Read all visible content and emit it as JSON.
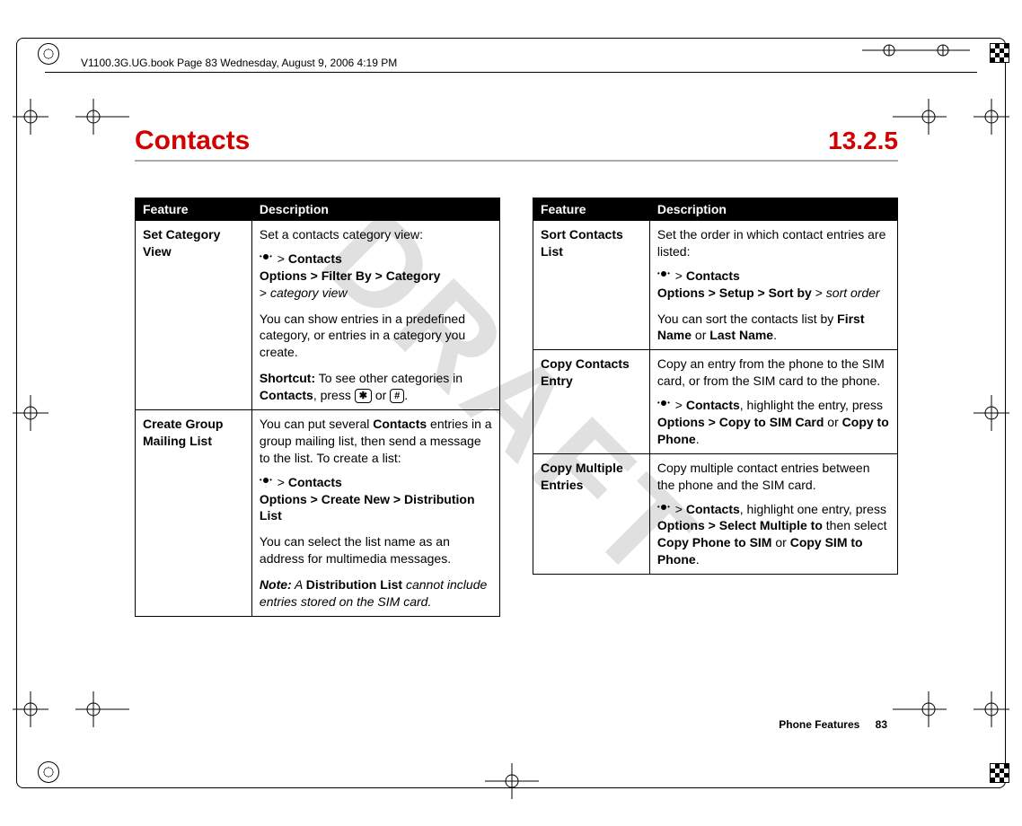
{
  "meta": {
    "book_header": "V1100.3G.UG.book  Page 83  Wednesday, August 9, 2006  4:19 PM",
    "watermark": "DRAFT"
  },
  "header": {
    "title": "Contacts",
    "section": "13.2.5"
  },
  "table_headers": {
    "feature": "Feature",
    "description": "Description"
  },
  "left_rows": [
    {
      "feature": "Set Category View",
      "intro": "Set a contacts category view:",
      "path_line1_a": "Contacts",
      "path_line2": "Options > Filter By > Category",
      "path_line3_prefix": "> ",
      "path_line3_ital": "category view",
      "body1": "You can show entries in a predefined category, or entries in a category you create.",
      "shortcut_label": "Shortcut:",
      "shortcut_text_a": " To see other categories in ",
      "shortcut_menu": "Contacts",
      "shortcut_text_b": ", press ",
      "key1": "✱",
      "shortcut_or": " or ",
      "key2": "#",
      "shortcut_end": "."
    },
    {
      "feature": "Create Group Mailing List",
      "intro_a": "You can put several ",
      "intro_menu": "Contacts",
      "intro_b": " entries in a group mailing list, then send a message to the list. To create a list:",
      "path_line1_a": "Contacts",
      "path_line2": "Options > Create New > Distribution List",
      "body1": "You can select the list name as an address for multimedia messages.",
      "note_label": "Note:",
      "note_ital_a": " A ",
      "note_menu": "Distribution List",
      "note_ital_b": " cannot include entries stored on the SIM card."
    }
  ],
  "right_rows": [
    {
      "feature": "Sort Contacts List",
      "intro": "Set the order in which contact entries are listed:",
      "path_line1_a": "Contacts",
      "path_line2_a": "Options > Setup > Sort by",
      "path_line2_sep": " > ",
      "path_line2_ital": "sort order",
      "body_a": "You can sort the contacts list by ",
      "body_menu1": "First Name",
      "body_mid": " or ",
      "body_menu2": "Last Name",
      "body_end": "."
    },
    {
      "feature": "Copy Contacts Entry",
      "intro": "Copy an entry from the phone to the SIM card, or from the SIM card to the phone.",
      "path_a": "Contacts",
      "path_b": ", highlight the entry, press ",
      "path_menu2": "Options > Copy to SIM Card",
      "path_or": " or ",
      "path_menu3": "Copy to Phone",
      "path_end": "."
    },
    {
      "feature": "Copy Multiple Entries",
      "intro": "Copy multiple contact entries between the phone and the SIM card.",
      "path_a": "Contacts",
      "path_b": ", highlight one entry, press ",
      "path_menu2": "Options > Select Multiple to",
      "path_c": " then select ",
      "path_menu3": "Copy Phone to SIM",
      "path_or": " or ",
      "path_menu4": "Copy SIM to Phone",
      "path_end": "."
    }
  ],
  "footer": {
    "label": "Phone Features",
    "page": "83"
  }
}
